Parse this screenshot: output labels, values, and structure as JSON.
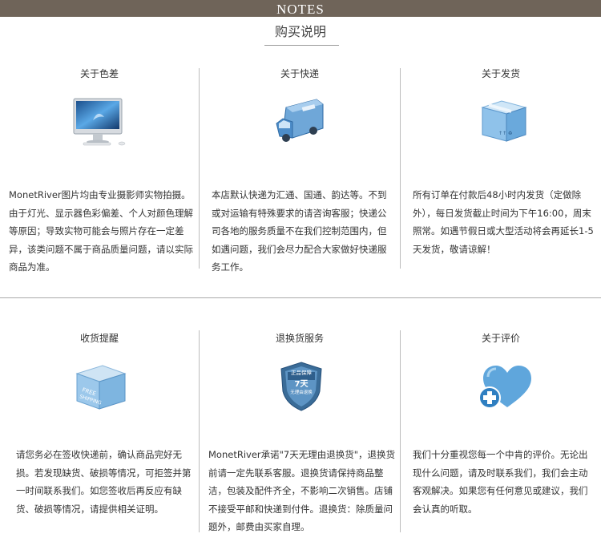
{
  "header": {
    "title": "NOTES",
    "subtitle": "购买说明"
  },
  "sections": [
    {
      "items": [
        {
          "title": "关于色差",
          "icon": "monitor-icon",
          "body": "MonetRiver图片均由专业摄影师实物拍摄。由于灯光、显示器色彩偏差、个人对颜色理解等原因；导致实物可能会与照片存在一定差异，该类问题不属于商品质量问题，请以实际商品为准。"
        },
        {
          "title": "关于快递",
          "icon": "delivery-van-icon",
          "body": "本店默认快递为汇通、国通、韵达等。不到或对运输有特殊要求的请咨询客服；快递公司各地的服务质量不在我们控制范围内，但如遇问题，我们会尽力配合大家做好快递服务工作。"
        },
        {
          "title": "关于发货",
          "icon": "package-box-icon",
          "body": "所有订单在付款后48小时内发货（定做除外），每日发货截止时间为下午16:00，周末照常。如遇节假日或大型活动将会再延长1-5天发货，敬请谅解！"
        }
      ]
    },
    {
      "items": [
        {
          "title": "收货提醒",
          "icon": "shipping-box-icon",
          "body": "请您务必在签收快递前，确认商品完好无损。若发现缺货、破损等情况，可拒签并第一时间联系我们。如您签收后再反应有缺货、破损等情况，请提供相关证明。"
        },
        {
          "title": "退换货服务",
          "icon": "shield-icon",
          "badge_lines": [
            "正品保障",
            "7天",
            "无理由退换"
          ],
          "body": "MonetRiver承诺\"7天无理由退换货\"，退换货前请一定先联系客服。退换货请保持商品整洁，包装及配件齐全，不影响二次销售。店铺不接受平邮和快递到付件。退换货：除质量问题外，邮费由买家自理。"
        },
        {
          "title": "关于评价",
          "icon": "heart-plus-icon",
          "body": "我们十分重视您每一个中肯的评价。无论出现什么问题，请及时联系我们，我们会主动客观解决。如果您有任何意见或建议，我们会认真的听取。"
        }
      ]
    }
  ],
  "colors": {
    "header_bar": "#6f6459",
    "icon_blue": "#4d95cf",
    "icon_light": "#a9d3ef",
    "divider": "#bdbdbd"
  }
}
